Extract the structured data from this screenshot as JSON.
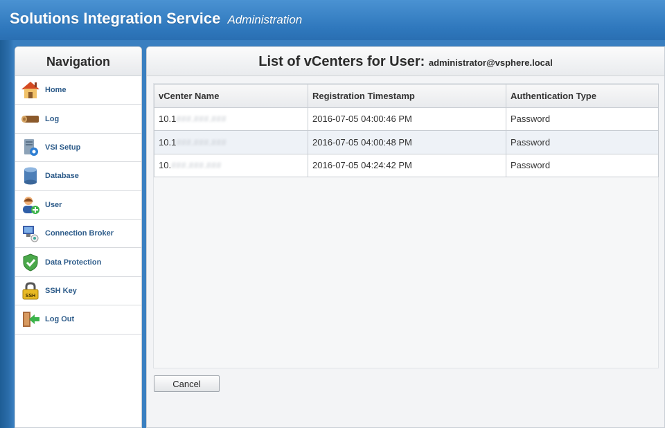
{
  "header": {
    "title": "Solutions Integration Service",
    "subtitle": "Administration"
  },
  "nav": {
    "title": "Navigation",
    "items": [
      {
        "label": "Home",
        "icon": "home-icon"
      },
      {
        "label": "Log",
        "icon": "log-icon"
      },
      {
        "label": "VSI Setup",
        "icon": "vsi-setup-icon"
      },
      {
        "label": "Database",
        "icon": "database-icon"
      },
      {
        "label": "User",
        "icon": "user-icon"
      },
      {
        "label": "Connection Broker",
        "icon": "connection-broker-icon"
      },
      {
        "label": "Data Protection",
        "icon": "shield-icon"
      },
      {
        "label": "SSH Key",
        "icon": "lock-icon"
      },
      {
        "label": "Log Out",
        "icon": "logout-icon"
      }
    ]
  },
  "main": {
    "title": "List of vCenters for User:",
    "user": "administrator@vsphere.local",
    "columns": [
      "vCenter Name",
      "Registration Timestamp",
      "Authentication Type"
    ],
    "rows": [
      {
        "name_prefix": "10.1",
        "name_masked": "###.###.###",
        "timestamp": "2016-07-05 04:00:46 PM",
        "auth": "Password"
      },
      {
        "name_prefix": "10.1",
        "name_masked": "###.###.###",
        "timestamp": "2016-07-05 04:00:48 PM",
        "auth": "Password"
      },
      {
        "name_prefix": "10.",
        "name_masked": "###.###.###",
        "timestamp": "2016-07-05 04:24:42 PM",
        "auth": "Password"
      }
    ],
    "cancel_label": "Cancel"
  },
  "colors": {
    "header_blue": "#2f78bd",
    "nav_label": "#2e5c8a"
  }
}
